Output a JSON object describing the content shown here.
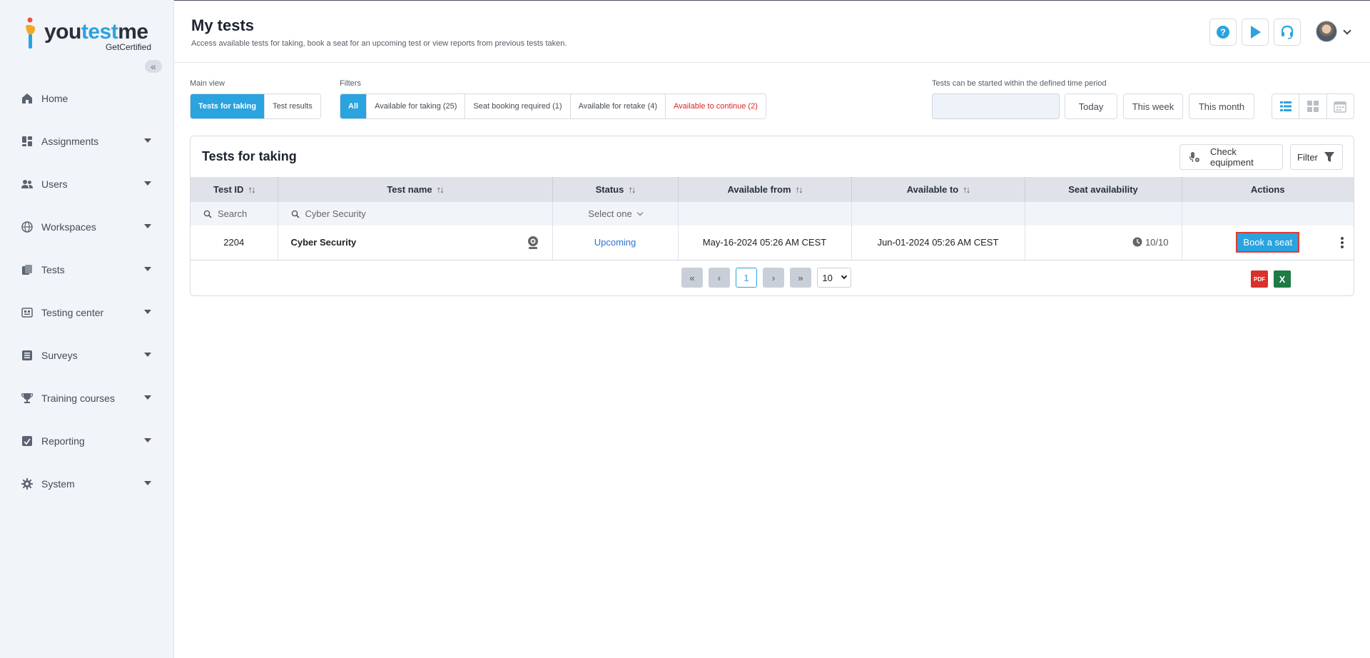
{
  "brand": {
    "word_prefix": "you",
    "word_accent": "test",
    "word_suffix": "me",
    "tagline": "GetCertified"
  },
  "sidebar": {
    "items": [
      {
        "label": "Home",
        "icon": "home-icon",
        "has_caret": false
      },
      {
        "label": "Assignments",
        "icon": "assignments-icon",
        "has_caret": true
      },
      {
        "label": "Users",
        "icon": "users-icon",
        "has_caret": true
      },
      {
        "label": "Workspaces",
        "icon": "globe-icon",
        "has_caret": true
      },
      {
        "label": "Tests",
        "icon": "tests-icon",
        "has_caret": true
      },
      {
        "label": "Testing center",
        "icon": "testing-center-icon",
        "has_caret": true
      },
      {
        "label": "Surveys",
        "icon": "surveys-icon",
        "has_caret": true
      },
      {
        "label": "Training courses",
        "icon": "trophy-icon",
        "has_caret": true
      },
      {
        "label": "Reporting",
        "icon": "reporting-icon",
        "has_caret": true
      },
      {
        "label": "System",
        "icon": "gear-icon",
        "has_caret": true
      }
    ]
  },
  "header": {
    "title": "My tests",
    "subtitle": "Access available tests for taking, book a seat for an upcoming test or view reports from previous tests taken."
  },
  "main_view": {
    "label": "Main view",
    "options": [
      "Tests for taking",
      "Test results"
    ],
    "active": "Tests for taking"
  },
  "filters": {
    "label": "Filters",
    "options": [
      "All",
      "Available for taking (25)",
      "Seat booking required (1)",
      "Available for retake (4)",
      "Available to continue (2)"
    ],
    "active": "All"
  },
  "period": {
    "label": "Tests can be started within the defined time period",
    "date_value": "",
    "buttons": [
      "Today",
      "This week",
      "This month"
    ]
  },
  "card": {
    "title": "Tests for taking",
    "check_equipment": "Check equipment",
    "filter": "Filter"
  },
  "table": {
    "columns": [
      "Test ID",
      "Test name",
      "Status",
      "Available from",
      "Available to",
      "Seat availability",
      "Actions"
    ],
    "filters": {
      "id_placeholder": "Search",
      "name_value": "Cyber Security",
      "status_placeholder": "Select one"
    },
    "rows": [
      {
        "id": "2204",
        "name": "Cyber Security",
        "status": "Upcoming",
        "from": "May-16-2024 05:26 AM CEST",
        "to": "Jun-01-2024 05:26 AM CEST",
        "seats": "10/10",
        "action": "Book a seat"
      }
    ]
  },
  "pagination": {
    "current": "1",
    "page_size": "10"
  },
  "colors": {
    "accent": "#2aa3de",
    "danger": "#e02424",
    "link": "#2f6fd1"
  }
}
